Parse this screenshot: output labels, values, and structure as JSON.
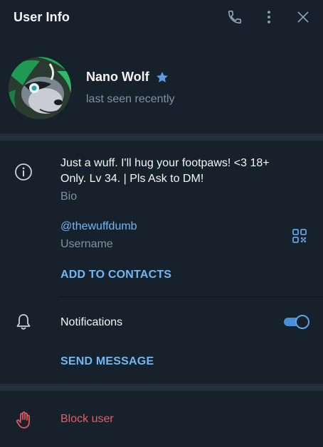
{
  "header": {
    "title": "User Info",
    "icons": [
      "phone-icon",
      "more-vertical-icon",
      "close-icon"
    ]
  },
  "profile": {
    "name": "Nano Wolf",
    "status": "last seen recently",
    "badge_icon": "star-icon"
  },
  "info": {
    "bio_text": "Just a wuff. I'll hug your footpaws! <3 18+ Only. Lv 34. | Pls Ask to DM!",
    "bio_line1": "Just a wuff. I'll hug your footpaws! <3 18+",
    "bio_line2": "Only. Lv 34. | Pls Ask to DM!",
    "bio_label": "Bio",
    "username": "@thewuffdumb",
    "username_label": "Username",
    "add_contacts": "ADD TO CONTACTS"
  },
  "notifications": {
    "label": "Notifications",
    "enabled": true,
    "send_message": "SEND MESSAGE"
  },
  "block": {
    "label": "Block user"
  },
  "colors": {
    "background": "#17212b",
    "divider": "#232e3c",
    "accent": "#71b7f3",
    "muted": "#7f91a4",
    "danger": "#e85b63"
  }
}
